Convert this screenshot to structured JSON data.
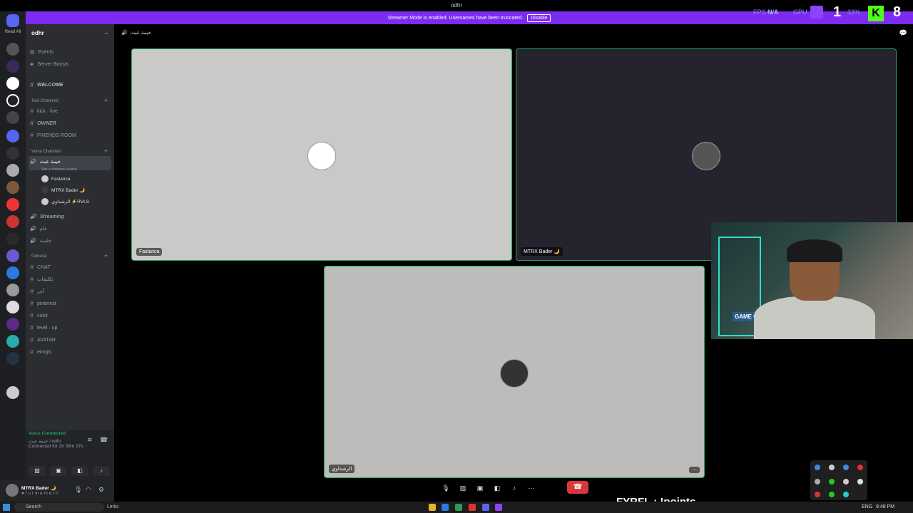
{
  "window": {
    "title": "odhr"
  },
  "banner": {
    "text": "Streamer Mode is enabled. Usernames have been truncated.",
    "disable_label": "Disable"
  },
  "overlay": {
    "fps_label": "FPS",
    "fps_value": "N/A",
    "gpu_label": "GPU",
    "cpu_value": "33%",
    "big_num_1": "1",
    "big_num_2": "8"
  },
  "server_rail": {
    "read_all": "Read All"
  },
  "server": {
    "name": "odhr"
  },
  "channels": {
    "events": "Events",
    "server_boosts": "Server Boosts",
    "welcome": "WELCOME",
    "text_category": "Text Channels",
    "kick_live": "kick · live",
    "owner": "OWNER",
    "friends_room": "FRIENDS-ROOM",
    "voice_category": "Voice Channels",
    "active_voice": "خيمة عيث",
    "channel_status": "Set a channel status",
    "voice_users": [
      "Faslanca",
      "MTRX Bader 🌙",
      "الرشداوي ⚡RVLS"
    ],
    "streaming": "Streaming",
    "aam": "عام",
    "sharing": "جلسة",
    "general_category": "General",
    "chat": "CHAT",
    "taklifat": "تكليفات",
    "ajr": "أجر",
    "pinterest": "pinterest",
    "color": "color",
    "level_up": "level · up",
    "avatar": "AVATAR",
    "emojis": "emojis"
  },
  "voice_panel": {
    "status": "Voice Connected",
    "location": "خيمة عيث / odhr",
    "connected_time": "Connected for 2h 39m 37s"
  },
  "user_panel": {
    "name": "MTRX Bader 🌙",
    "status": "● f u r m e m e r h"
  },
  "main_header": {
    "channel": "خيمة عيث"
  },
  "tiles": [
    {
      "label": "Faslanca"
    },
    {
      "label": "MTRX Bader 🌙"
    },
    {
      "label": "الرشداوي",
      "more": "···"
    }
  ],
  "webcam": {
    "sign": "GAME OVER"
  },
  "points_overlay": {
    "text": "FYRFL : !points"
  },
  "taskbar": {
    "search_placeholder": "Search",
    "links_label": "Links",
    "lang": "ENG",
    "time": "9:48 PM"
  }
}
